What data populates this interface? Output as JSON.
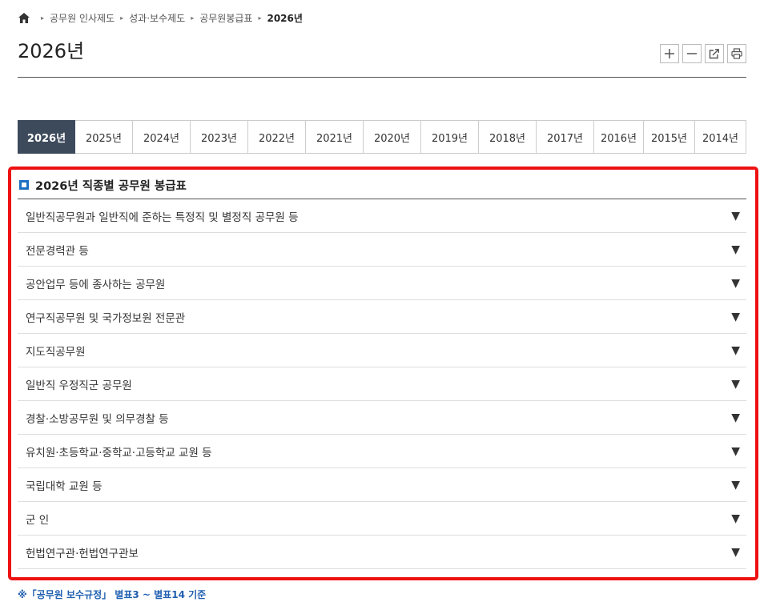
{
  "breadcrumb": {
    "home_icon": "home-icon",
    "items": [
      "공무원 인사제도",
      "성과·보수제도",
      "공무원봉급표",
      "2026년"
    ]
  },
  "page": {
    "title": "2026년"
  },
  "tools": [
    {
      "name": "zoom-in",
      "icon": "plus-icon"
    },
    {
      "name": "zoom-out",
      "icon": "minus-icon"
    },
    {
      "name": "share",
      "icon": "share-icon"
    },
    {
      "name": "print",
      "icon": "print-icon"
    }
  ],
  "year_tabs": {
    "active": "2026년",
    "items": [
      "2026년",
      "2025년",
      "2024년",
      "2023년",
      "2022년",
      "2021년",
      "2020년",
      "2019년",
      "2018년",
      "2017년",
      "2016년",
      "2015년",
      "2014년"
    ]
  },
  "section": {
    "title": "2026년 직종별 공무원 봉급표",
    "items": [
      "일반직공무원과 일반직에 준하는 특정직 및 별정직 공무원 등",
      "전문경력관 등",
      "공안업무 등에 종사하는 공무원",
      "연구직공무원 및 국가정보원 전문관",
      "지도직공무원",
      "일반직 우정직군 공무원",
      "경찰·소방공무원 및 의무경찰 등",
      "유치원·초등학교·중학교·고등학교 교원 등",
      "국립대학 교원 등",
      "군 인",
      "헌법연구관·헌법연구관보"
    ],
    "arrow_glyph": "▼"
  },
  "footnote": "※「공무원 보수규정」 별표3 ~ 별표14 기준",
  "colors": {
    "active_tab": "#3d4a5c",
    "highlight": "#ee1111",
    "accent": "#1d6fc2"
  }
}
